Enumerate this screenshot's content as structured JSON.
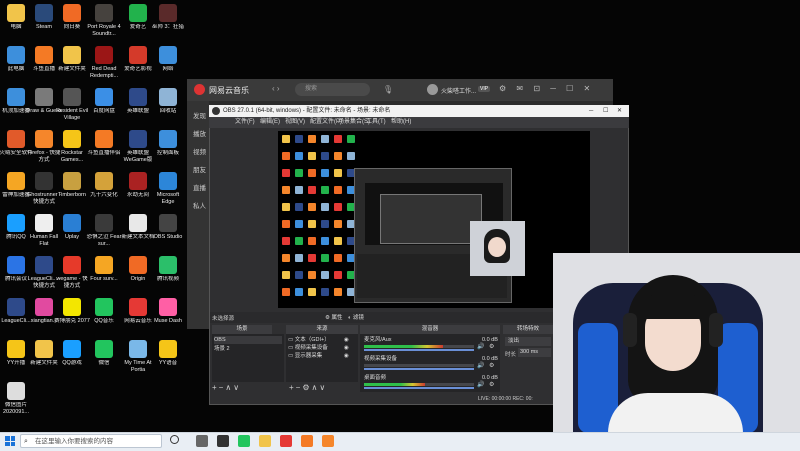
{
  "desktop_icons": [
    {
      "label": "电脑",
      "color": "#f1c44a"
    },
    {
      "label": "Steam",
      "color": "#2a4a7a"
    },
    {
      "label": "向日葵",
      "color": "#f06a25"
    },
    {
      "label": "Port Royale 4 Soundtr...",
      "color": "#46423e"
    },
    {
      "label": "爱奇艺",
      "color": "#22b24c"
    },
    {
      "label": "巫师 3：狂猎",
      "color": "#5a2a2a"
    },
    {
      "label": "此电脑",
      "color": "#3d8fdc"
    },
    {
      "label": "斗鱼直播",
      "color": "#f47a25"
    },
    {
      "label": "新建文件夹",
      "color": "#f1c44a"
    },
    {
      "label": "Red Dead Redempti...",
      "color": "#9b1616"
    },
    {
      "label": "爱奇艺影视",
      "color": "#d43a2a"
    },
    {
      "label": "网络",
      "color": "#3d8fdc"
    },
    {
      "label": "机顶加速器",
      "color": "#3d8fdc"
    },
    {
      "label": "Draw & Guess",
      "color": "#7a7a7a"
    },
    {
      "label": "Resident Evil Village",
      "color": "#555"
    },
    {
      "label": "百度网盘",
      "color": "#3b8fe6"
    },
    {
      "label": "英雄联盟",
      "color": "#2e4a8a"
    },
    {
      "label": "回收站",
      "color": "#8fb4d6"
    },
    {
      "label": "火绒安全软件",
      "color": "#e15a2a"
    },
    {
      "label": "Firefox - 快捷方式",
      "color": "#f5862b"
    },
    {
      "label": "Rockstar Games...",
      "color": "#f5c518"
    },
    {
      "label": "斗鱼直播伴侣",
      "color": "#f47a25"
    },
    {
      "label": "英雄联盟WeGame版",
      "color": "#2e4a8a"
    },
    {
      "label": "控制面板",
      "color": "#3d8fdc"
    },
    {
      "label": "雷神加速器",
      "color": "#f5a623"
    },
    {
      "label": "Ghostrunner - 快捷方式",
      "color": "#333"
    },
    {
      "label": "Timberborn",
      "color": "#c8a040"
    },
    {
      "label": "九十六变化",
      "color": "#d4a23a"
    },
    {
      "label": "永劫无间",
      "color": "#a22"
    },
    {
      "label": "Microsoft Edge",
      "color": "#2c86d9"
    },
    {
      "label": "腾讯QQ",
      "color": "#1a9fff"
    },
    {
      "label": "Human Fall Flat",
      "color": "#eee"
    },
    {
      "label": "Uplay",
      "color": "#2a7fd4"
    },
    {
      "label": "恐惧之泣 Fear sur...",
      "color": "#3a3a3a"
    },
    {
      "label": "新建文本文档",
      "color": "#e8e8e8"
    },
    {
      "label": "OBS Studio",
      "color": "#444"
    },
    {
      "label": "腾讯会议",
      "color": "#2b74e5"
    },
    {
      "label": "LeagueCli... - 快捷方式",
      "color": "#2e4a8a"
    },
    {
      "label": "wegame - 快捷方式",
      "color": "#e63a2a"
    },
    {
      "label": "Four surv...",
      "color": "#f5a623"
    },
    {
      "label": "Origin",
      "color": "#f06a25"
    },
    {
      "label": "腾讯视频",
      "color": "#2bbf6a"
    },
    {
      "label": "LeagueCli...",
      "color": "#2e4a8a"
    },
    {
      "label": "xiangtian...",
      "color": "#e14aa0"
    },
    {
      "label": "赛博朋克 2077",
      "color": "#f3e600"
    },
    {
      "label": "QQ音乐",
      "color": "#22c55e"
    },
    {
      "label": "网易云音乐",
      "color": "#e53935"
    },
    {
      "label": "Muse Dash",
      "color": "#ff5fa5"
    },
    {
      "label": "YY开播",
      "color": "#f5c518"
    },
    {
      "label": "新建文件夹",
      "color": "#f1c44a"
    },
    {
      "label": "QQ游戏",
      "color": "#1a9fff"
    },
    {
      "label": "微信",
      "color": "#22c55e"
    },
    {
      "label": "My Time At Portia",
      "color": "#7ab8e8"
    },
    {
      "label": "YY语音",
      "color": "#f5c518"
    },
    {
      "label": "微信图片 2020091...",
      "color": "#ddd"
    }
  ],
  "taskbar": {
    "search_placeholder": "在这里输入你要搜索的内容",
    "apps": [
      {
        "name": "task-view",
        "color": "#666"
      },
      {
        "name": "obs",
        "color": "#333"
      },
      {
        "name": "wechat",
        "color": "#22c55e"
      },
      {
        "name": "folder",
        "color": "#f1c44a"
      },
      {
        "name": "netease-music",
        "color": "#e53935"
      },
      {
        "name": "douyu",
        "color": "#f47a25"
      },
      {
        "name": "firefox",
        "color": "#f5862b"
      }
    ]
  },
  "music": {
    "app_title": "网易云音乐",
    "search_placeholder": "搜索",
    "user_name": "火柴嗒工作...",
    "sidebar": [
      "发现",
      "播放",
      "视频",
      "朋友",
      "直播",
      "私人"
    ]
  },
  "obs": {
    "title": "OBS 27.0.1 (64-bit, windows) - 配置文件: 未命名 - 场景: 未命名",
    "menu": [
      "文件(F)",
      "编辑(E)",
      "视图(V)",
      "配置文件(P)",
      "场景集合(S)",
      "工具(T)",
      "帮助(H)"
    ],
    "source_notice": "未选择源",
    "btn_properties": "属性",
    "btn_filters": "滤镜",
    "scenes_header": "场景",
    "scenes": [
      "OBS",
      "场景 2"
    ],
    "sources_header": "来源",
    "sources": [
      "文本（GDI+）",
      "视频采集设备",
      "显示器采集"
    ],
    "mixer_header": "混音器",
    "mixer": [
      {
        "name": "麦克风/Aux",
        "db": "0.0 dB",
        "level": 0.72
      },
      {
        "name": "视频采集设备",
        "db": "0.0 dB",
        "level": 0.0
      },
      {
        "name": "桌面音频",
        "db": "0.0 dB",
        "level": 0.55
      }
    ],
    "transition_header": "转场特效",
    "transition_value": "淡出",
    "duration_label": "时长",
    "duration_value": "300 ms",
    "status": "LIVE: 00:00:00  REC: 00:"
  }
}
